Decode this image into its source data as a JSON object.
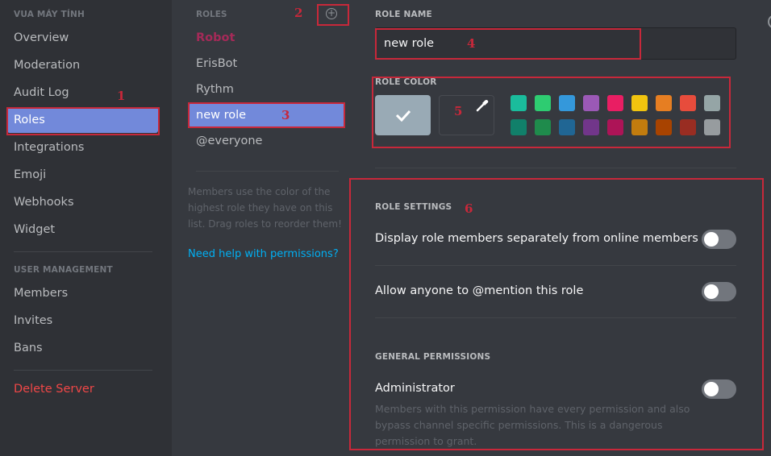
{
  "sidebar": {
    "server_header": "VUA MÁY TÍNH",
    "items": [
      {
        "label": "Overview"
      },
      {
        "label": "Moderation"
      },
      {
        "label": "Audit Log"
      },
      {
        "label": "Roles",
        "active": true
      },
      {
        "label": "Integrations"
      },
      {
        "label": "Emoji"
      },
      {
        "label": "Webhooks"
      },
      {
        "label": "Widget"
      }
    ],
    "user_mgmt_header": "USER MANAGEMENT",
    "user_items": [
      {
        "label": "Members"
      },
      {
        "label": "Invites"
      },
      {
        "label": "Bans"
      }
    ],
    "delete_label": "Delete Server"
  },
  "roles": {
    "header": "ROLES",
    "add_icon": "plus-circle-icon",
    "items": [
      {
        "label": "Robot",
        "color": "#a52a58"
      },
      {
        "label": "ErisBot"
      },
      {
        "label": "Rythm"
      },
      {
        "label": "new role",
        "active": true
      },
      {
        "label": "@everyone"
      }
    ],
    "help_text": "Members use the color of the highest role they have on this list. Drag roles to reorder them!",
    "help_link": "Need help with permissions?"
  },
  "main": {
    "role_name_label": "ROLE NAME",
    "role_name_value": "new role",
    "role_color_label": "ROLE COLOR",
    "default_color": "#99aab5",
    "check_icon": "checkmark-icon",
    "dropper_icon": "eyedropper-icon",
    "swatches_row1": [
      "#1abc9c",
      "#2ecc71",
      "#3498db",
      "#9b59b6",
      "#e91e63",
      "#f1c40f",
      "#e67e22",
      "#e74c3c",
      "#95a5a6"
    ],
    "swatches_row2": [
      "#11806a",
      "#1f8b4c",
      "#206694",
      "#71368a",
      "#ad1457",
      "#c27c0e",
      "#a84300",
      "#992d22",
      "#979c9f"
    ],
    "role_settings_label": "ROLE SETTINGS",
    "settings": [
      {
        "label": "Display role members separately from online members",
        "enabled": false
      },
      {
        "label": "Allow anyone to @mention this role",
        "enabled": false
      }
    ],
    "general_permissions_label": "GENERAL PERMISSIONS",
    "permissions": [
      {
        "label": "Administrator",
        "enabled": false,
        "description": "Members with this permission have every permission and also bypass channel specific permissions. This is a dangerous permission to grant."
      }
    ]
  },
  "annotations": [
    "1",
    "2",
    "3",
    "4",
    "5",
    "6"
  ]
}
